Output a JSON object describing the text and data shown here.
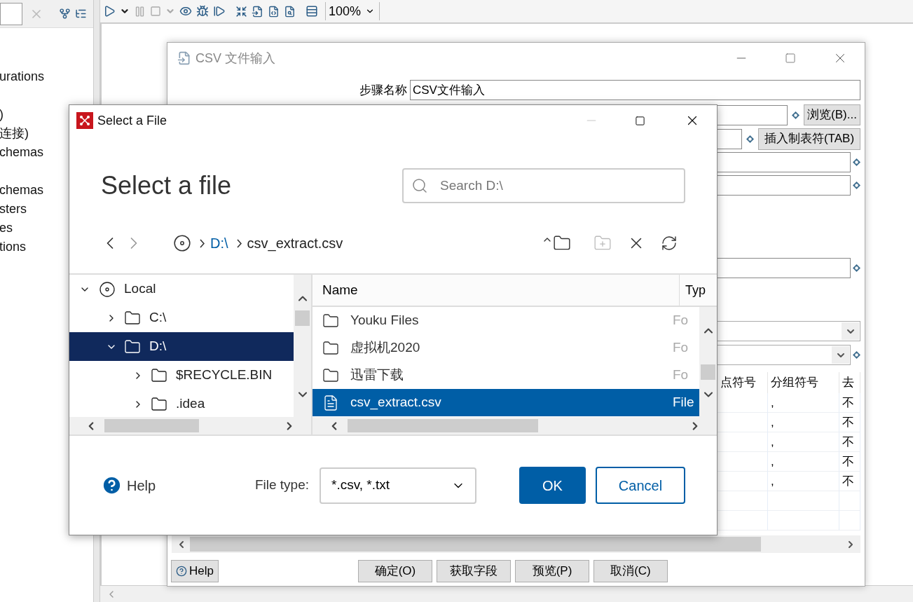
{
  "sidebar": {
    "groups": [
      [
        "urations"
      ],
      [
        ")",
        "连接)",
        "chemas"
      ],
      [
        "chemas",
        "sters",
        "es",
        "tions"
      ]
    ]
  },
  "toolbar": {
    "zoom": "100%"
  },
  "step_dialog": {
    "title": "CSV 文件输入",
    "step_name_label": "步骤名称",
    "step_name_value": "CSV文件输入",
    "browse_button": "浏览(B)...",
    "tab_button": "插入制表符(TAB)",
    "table": {
      "columns": [
        "点符号",
        "分组符号",
        "去"
      ],
      "rows": [
        [
          "",
          ",",
          "不"
        ],
        [
          "",
          ",",
          "不"
        ],
        [
          "",
          ",",
          "不"
        ],
        [
          "",
          ",",
          "不"
        ],
        [
          "",
          ",",
          "不"
        ]
      ]
    },
    "help_button": "Help",
    "buttons": [
      "确定(O)",
      "获取字段",
      "预览(P)",
      "取消(C)"
    ]
  },
  "file_dialog": {
    "title": "Select a File",
    "heading": "Select a file",
    "search": {
      "placeholder": "Search D:\\"
    },
    "path": [
      {
        "label": "D:\\",
        "kind": "link"
      },
      {
        "label": "csv_extract.csv",
        "kind": "current"
      }
    ],
    "tree": [
      {
        "label": "Local",
        "kind": "drive",
        "expanded": true,
        "selected": false,
        "children": [
          {
            "label": "C:\\",
            "kind": "folder",
            "expanded": false,
            "selected": false
          },
          {
            "label": "D:\\",
            "kind": "folder",
            "expanded": true,
            "selected": true,
            "children": [
              {
                "label": "$RECYCLE.BIN",
                "kind": "folder",
                "expanded": false,
                "selected": false
              },
              {
                "label": ".idea",
                "kind": "folder",
                "expanded": false,
                "selected": false
              }
            ]
          }
        ]
      }
    ],
    "list": {
      "columns": [
        "Name",
        "Typ"
      ],
      "rows": [
        {
          "name": "Youku Files",
          "type": "Fo",
          "kind": "folder",
          "selected": false
        },
        {
          "name": "虚拟机2020",
          "type": "Fo",
          "kind": "folder",
          "selected": false
        },
        {
          "name": "迅雷下载",
          "type": "Fo",
          "kind": "folder",
          "selected": false
        },
        {
          "name": "csv_extract.csv",
          "type": "File",
          "kind": "file",
          "selected": true
        }
      ]
    },
    "help": "Help",
    "file_type_label": "File type:",
    "file_type_value": "*.csv, *.txt",
    "buttons": [
      {
        "label": "OK",
        "kind": "primary"
      },
      {
        "label": "Cancel",
        "kind": "secondary"
      }
    ]
  }
}
